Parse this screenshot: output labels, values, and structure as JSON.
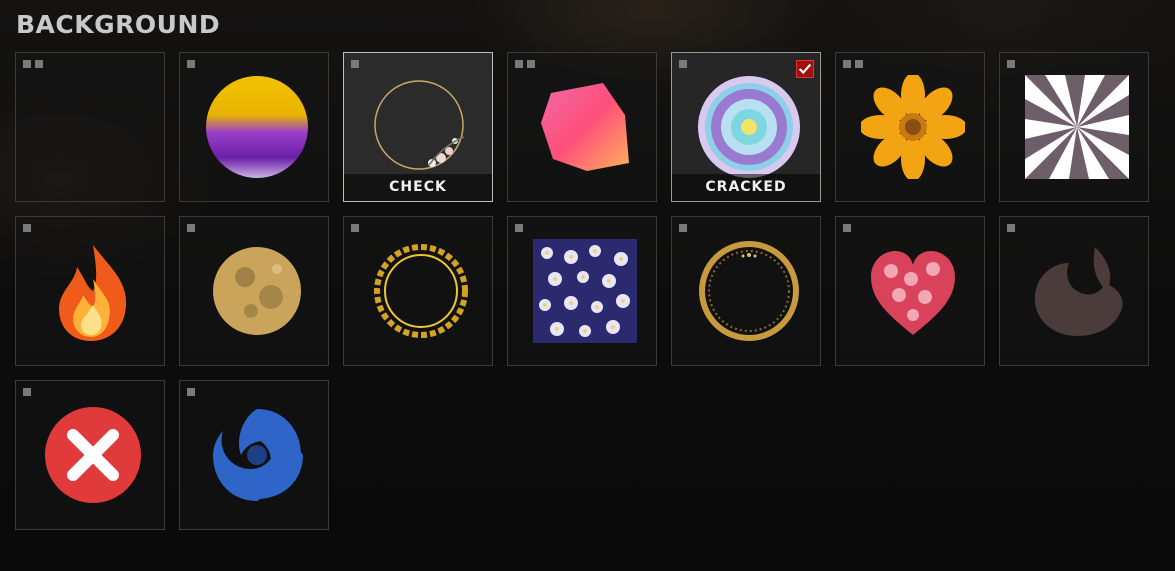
{
  "title": "BACKGROUND",
  "tiles": [
    {
      "name": "empty",
      "icon": "empty-slot",
      "caption": "",
      "dots": 2
    },
    {
      "name": "watercolor-sphere",
      "icon": "watercolor-sphere-icon",
      "caption": "",
      "dots": 1
    },
    {
      "name": "floral-wreath",
      "icon": "floral-wreath-icon",
      "caption": "CHECK",
      "dots": 1
    },
    {
      "name": "pink-watercolor",
      "icon": "pink-watercolor-splash-icon",
      "caption": "",
      "dots": 2
    },
    {
      "name": "mandala",
      "icon": "mandala-icon",
      "caption": "CRACKED",
      "dots": 1,
      "selected": true
    },
    {
      "name": "yellow-flower",
      "icon": "yellow-flower-icon",
      "caption": "",
      "dots": 2
    },
    {
      "name": "sunburst",
      "icon": "sunburst-icon",
      "caption": "",
      "dots": 1
    },
    {
      "name": "fire",
      "icon": "fire-icon",
      "caption": "",
      "dots": 1
    },
    {
      "name": "moon",
      "icon": "moon-icon",
      "caption": "",
      "dots": 1
    },
    {
      "name": "gold-ornate-frame",
      "icon": "ornate-frame-icon",
      "caption": "",
      "dots": 1
    },
    {
      "name": "daisy-pattern",
      "icon": "daisy-pattern-icon",
      "caption": "",
      "dots": 1
    },
    {
      "name": "gold-ring",
      "icon": "gold-ring-icon",
      "caption": "",
      "dots": 1
    },
    {
      "name": "rose-heart",
      "icon": "rose-heart-icon",
      "caption": "",
      "dots": 1
    },
    {
      "name": "dragon",
      "icon": "dragon-icon",
      "caption": "",
      "dots": 1
    },
    {
      "name": "red-x",
      "icon": "red-x-icon",
      "caption": "",
      "dots": 1
    },
    {
      "name": "blue-swirl",
      "icon": "blue-swirl-icon",
      "caption": "",
      "dots": 1
    }
  ],
  "colors": {
    "selected_check": "#a01010",
    "title": "#c9c9c9",
    "tile_border": "#3a3a3a"
  }
}
